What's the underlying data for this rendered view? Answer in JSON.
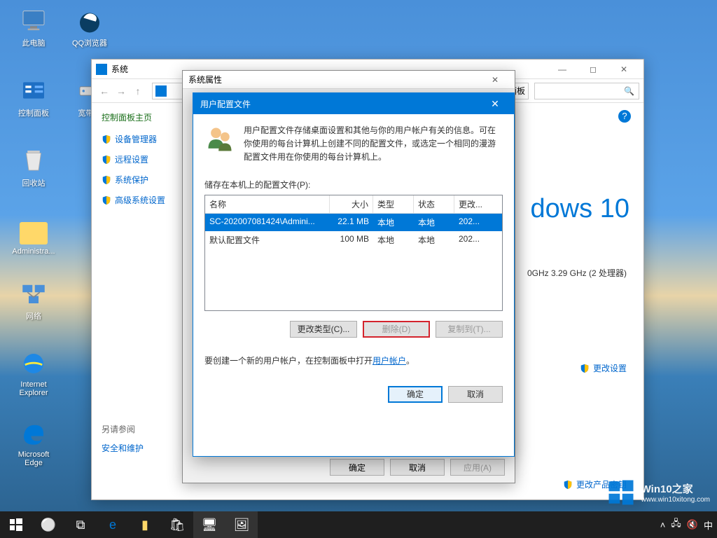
{
  "desktop": {
    "icons": [
      {
        "name": "此电脑"
      },
      {
        "name": "QQ浏览器"
      },
      {
        "name": "控制面板"
      },
      {
        "name": "宽带连"
      },
      {
        "name": "回收站"
      },
      {
        "name": "Administra..."
      },
      {
        "name": "网络"
      },
      {
        "name": "Internet Explorer"
      },
      {
        "name": "Microsoft Edge"
      }
    ]
  },
  "system_window": {
    "title": "系统",
    "address_crumbs": "控制面板",
    "search_placeholder": "",
    "sidebar_title": "控制面板主页",
    "sidebar_items": [
      "设备管理器",
      "远程设置",
      "系统保护",
      "高级系统设置"
    ],
    "also_title": "另请参阅",
    "also_item": "安全和维护",
    "brand_fragment": "dows 10",
    "spec_fragment": "0GHz   3.29 GHz  (2 处理器)",
    "change_settings": "更改设置",
    "change_key": "更改产品密钥"
  },
  "props_dialog": {
    "title": "系统属性",
    "ok": "确定",
    "cancel": "取消",
    "apply": "应用(A)"
  },
  "user_profiles": {
    "title": "用户配置文件",
    "description": "用户配置文件存储桌面设置和其他与你的用户帐户有关的信息。可在你使用的每台计算机上创建不同的配置文件，或选定一个相同的漫游配置文件用在你使用的每台计算机上。",
    "list_label": "储存在本机上的配置文件(P):",
    "columns": [
      "名称",
      "大小",
      "类型",
      "状态",
      "更改..."
    ],
    "rows": [
      {
        "name": "SC-202007081424\\Admini...",
        "size": "22.1 MB",
        "type": "本地",
        "state": "本地",
        "mod": "202..."
      },
      {
        "name": "默认配置文件",
        "size": "100 MB",
        "type": "本地",
        "state": "本地",
        "mod": "202..."
      }
    ],
    "btn_change_type": "更改类型(C)...",
    "btn_delete": "删除(D)",
    "btn_copy": "复制到(T)...",
    "create_text_pre": "要创建一个新的用户帐户，在控制面板中打开",
    "create_link": "用户帐户",
    "create_text_post": "。",
    "ok": "确定",
    "cancel": "取消"
  },
  "watermark": {
    "title": "Win10之家",
    "url": "www.win10xitong.com"
  }
}
